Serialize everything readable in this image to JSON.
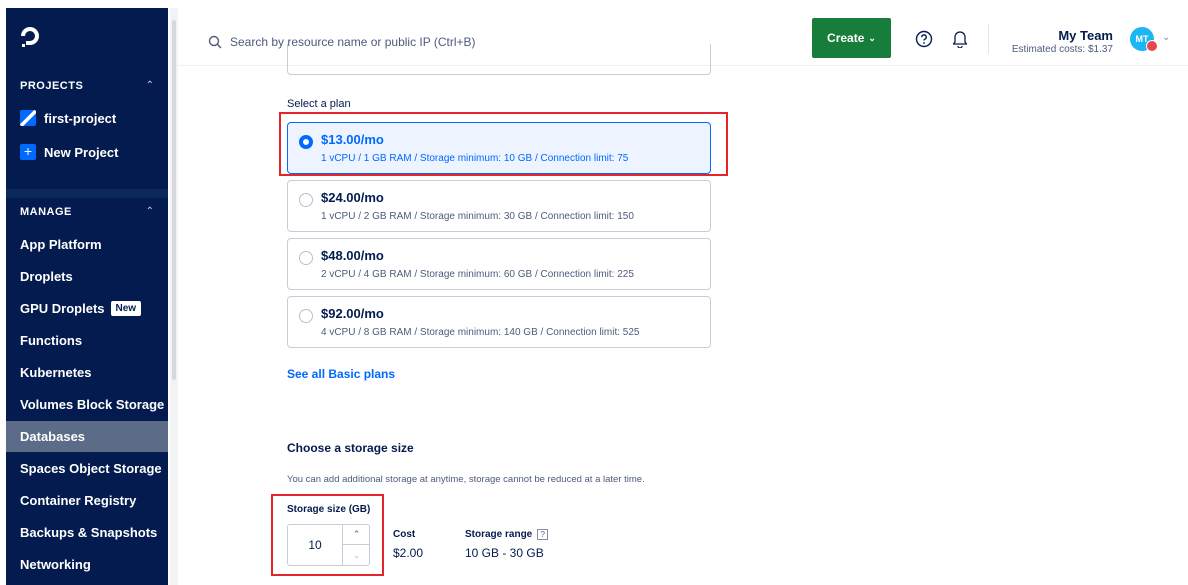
{
  "sidebar": {
    "projects_header": "PROJECTS",
    "projects": [
      {
        "label": "first-project"
      },
      {
        "label": "New Project"
      }
    ],
    "manage_header": "MANAGE",
    "nav": [
      {
        "label": "App Platform"
      },
      {
        "label": "Droplets"
      },
      {
        "label": "GPU Droplets",
        "badge": "New"
      },
      {
        "label": "Functions"
      },
      {
        "label": "Kubernetes"
      },
      {
        "label": "Volumes Block Storage"
      },
      {
        "label": "Databases",
        "active": true
      },
      {
        "label": "Spaces Object Storage"
      },
      {
        "label": "Container Registry"
      },
      {
        "label": "Backups & Snapshots"
      },
      {
        "label": "Networking"
      }
    ]
  },
  "topbar": {
    "search_placeholder": "Search by resource name or public IP (Ctrl+B)",
    "create_label": "Create",
    "team_name": "My Team",
    "estimated_costs": "Estimated costs: $1.37",
    "avatar_initials": "MT"
  },
  "plan": {
    "section_label": "Select a plan",
    "options": [
      {
        "price": "$13.00/mo",
        "desc": "1 vCPU / 1 GB RAM / Storage minimum: 10 GB / Connection limit: 75",
        "selected": true
      },
      {
        "price": "$24.00/mo",
        "desc": "1 vCPU / 2 GB RAM / Storage minimum: 30 GB / Connection limit: 150",
        "selected": false
      },
      {
        "price": "$48.00/mo",
        "desc": "2 vCPU / 4 GB RAM / Storage minimum: 60 GB / Connection limit: 225",
        "selected": false
      },
      {
        "price": "$92.00/mo",
        "desc": "4 vCPU / 8 GB RAM / Storage minimum: 140 GB / Connection limit: 525",
        "selected": false
      }
    ],
    "see_all_label": "See all Basic plans"
  },
  "storage": {
    "title": "Choose a storage size",
    "help_text": "You can add additional storage at anytime, storage cannot be reduced at a later time.",
    "size_label": "Storage size (GB)",
    "size_value": "10",
    "cost_label": "Cost",
    "cost_value": "$2.00",
    "range_label": "Storage range",
    "range_help": "?",
    "range_value": "10 GB - 30 GB"
  },
  "colors": {
    "sidebar_bg": "#031b4e",
    "accent": "#0069ff",
    "create_button": "#167d3a",
    "highlight": "#e5242b"
  },
  "icons": {
    "logo": "digitalocean-logo-icon",
    "search": "search-icon",
    "help": "help-circle-icon",
    "bell": "bell-icon",
    "chevron": "chevron-down-icon"
  }
}
